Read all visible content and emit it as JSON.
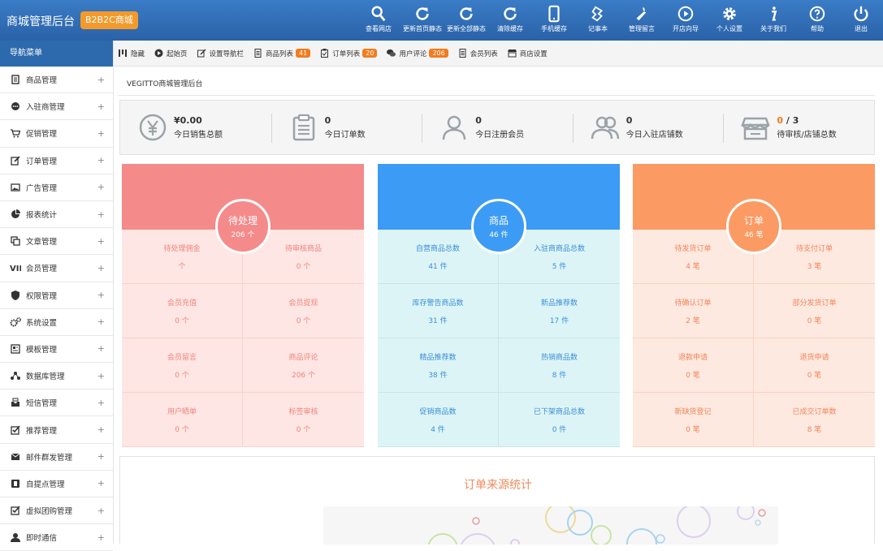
{
  "header": {
    "title": "商城管理后台",
    "badge": "B2B2C商城",
    "nav": [
      {
        "label": "查看网店",
        "icon": "search-icon"
      },
      {
        "label": "更新首页静态",
        "icon": "refresh-icon"
      },
      {
        "label": "更新全部静态",
        "icon": "refresh-icon"
      },
      {
        "label": "清除缓存",
        "icon": "refresh-icon"
      },
      {
        "label": "手机缓存",
        "icon": "mobile-icon"
      },
      {
        "label": "记事本",
        "icon": "notepad-icon"
      },
      {
        "label": "管理留言",
        "icon": "wrench-icon"
      },
      {
        "label": "开店向导",
        "icon": "play-icon"
      },
      {
        "label": "个人设置",
        "icon": "gear-icon"
      },
      {
        "label": "关于我们",
        "icon": "info-icon"
      },
      {
        "label": "帮助",
        "icon": "help-icon"
      },
      {
        "label": "退出",
        "icon": "power-icon"
      }
    ]
  },
  "sidebar": {
    "title": "导航菜单",
    "items": [
      {
        "label": "商品管理",
        "icon": "document-icon"
      },
      {
        "label": "入驻商管理",
        "icon": "chat-bubble-icon"
      },
      {
        "label": "促销管理",
        "icon": "cart-icon"
      },
      {
        "label": "订单管理",
        "icon": "edit-icon"
      },
      {
        "label": "广告管理",
        "icon": "image-icon"
      },
      {
        "label": "报表统计",
        "icon": "pie-chart-icon"
      },
      {
        "label": "文章管理",
        "icon": "copy-icon"
      },
      {
        "label": "会员管理",
        "icon": "vip-icon"
      },
      {
        "label": "权限管理",
        "icon": "shield-icon"
      },
      {
        "label": "系统设置",
        "icon": "gears-icon"
      },
      {
        "label": "模板管理",
        "icon": "template-icon"
      },
      {
        "label": "数据库管理",
        "icon": "share-icon"
      },
      {
        "label": "短信管理",
        "icon": "inbox-icon"
      },
      {
        "label": "推荐管理",
        "icon": "checkbox-icon"
      },
      {
        "label": "邮件群发管理",
        "icon": "mail-icon"
      },
      {
        "label": "自提点管理",
        "icon": "book-icon"
      },
      {
        "label": "虚拟团购管理",
        "icon": "checkbox-icon"
      },
      {
        "label": "即时通信",
        "icon": "user-icon"
      }
    ],
    "expand": "+"
  },
  "toolbar": {
    "items": [
      {
        "label": "隐藏",
        "icon": "bars-icon",
        "count": ""
      },
      {
        "label": "起始页",
        "icon": "play-circle-icon",
        "count": ""
      },
      {
        "label": "设置导航栏",
        "icon": "edit-icon",
        "count": ""
      },
      {
        "label": "商品列表",
        "icon": "document-icon",
        "count": "41"
      },
      {
        "label": "订单列表",
        "icon": "clipboard-icon",
        "count": "20"
      },
      {
        "label": "用户评论",
        "icon": "chat-icon",
        "count": "206"
      },
      {
        "label": "会员列表",
        "icon": "document-icon",
        "count": ""
      },
      {
        "label": "商店设置",
        "icon": "shop-icon",
        "count": ""
      }
    ]
  },
  "breadcrumb": "VEGITTO商城管理后台",
  "stats": [
    {
      "value": "¥0.00",
      "label": "今日销售总额",
      "icon": "yen-icon"
    },
    {
      "value": "0",
      "label": "今日订单数",
      "icon": "clipboard-icon"
    },
    {
      "value": "0",
      "label": "今日注册会员",
      "icon": "user-icon"
    },
    {
      "value": "0",
      "label": "今日入驻店铺数",
      "icon": "users-icon"
    },
    {
      "value_highlight": "0",
      "value_rest": " / 3",
      "label": "待审核/店铺总数",
      "icon": "shop-icon"
    }
  ],
  "cards": [
    {
      "title": "待处理",
      "count": "206 个",
      "colors": {
        "head": "#f58a8a",
        "body": "#fde6e3",
        "text": "#f0857d"
      },
      "cells": [
        {
          "label": "待处理佣金",
          "value": "个"
        },
        {
          "label": "待审核商品",
          "value": "0 个"
        },
        {
          "label": "会员充值",
          "value": "0 个"
        },
        {
          "label": "会员提现",
          "value": "0 个"
        },
        {
          "label": "会员留言",
          "value": "0 个"
        },
        {
          "label": "商品评论",
          "value": "206 个"
        },
        {
          "label": "用户晒单",
          "value": "0 个"
        },
        {
          "label": "标签审核",
          "value": "0 个"
        }
      ]
    },
    {
      "title": "商品",
      "count": "46 件",
      "colors": {
        "head": "#3c9bf4",
        "body": "#ddf4f6",
        "text": "#3a8fd8"
      },
      "cells": [
        {
          "label": "自营商品总数",
          "value": "41 件"
        },
        {
          "label": "入驻商商品总数",
          "value": "5 件"
        },
        {
          "label": "库存警告商品数",
          "value": "31 件"
        },
        {
          "label": "新品推荐数",
          "value": "17 件"
        },
        {
          "label": "精品推荐数",
          "value": "38 件"
        },
        {
          "label": "热销商品数",
          "value": "8 件"
        },
        {
          "label": "促销商品数",
          "value": "4 件"
        },
        {
          "label": "已下架商品总数",
          "value": "0 件"
        }
      ]
    },
    {
      "title": "订单",
      "count": "46 笔",
      "colors": {
        "head": "#fb9a63",
        "body": "#fde9e0",
        "text": "#f2855a"
      },
      "cells": [
        {
          "label": "待发货订单",
          "value": "4 笔"
        },
        {
          "label": "待支付订单",
          "value": "3 笔"
        },
        {
          "label": "待确认订单",
          "value": "2 笔"
        },
        {
          "label": "部分发货订单",
          "value": "0 笔"
        },
        {
          "label": "退款申请",
          "value": "0 笔"
        },
        {
          "label": "退货申请",
          "value": "0 笔"
        },
        {
          "label": "新缺货登记",
          "value": "0 笔"
        },
        {
          "label": "已成交订单数",
          "value": "8 笔"
        }
      ]
    }
  ],
  "chart_section": {
    "title": "订单来源统计"
  }
}
